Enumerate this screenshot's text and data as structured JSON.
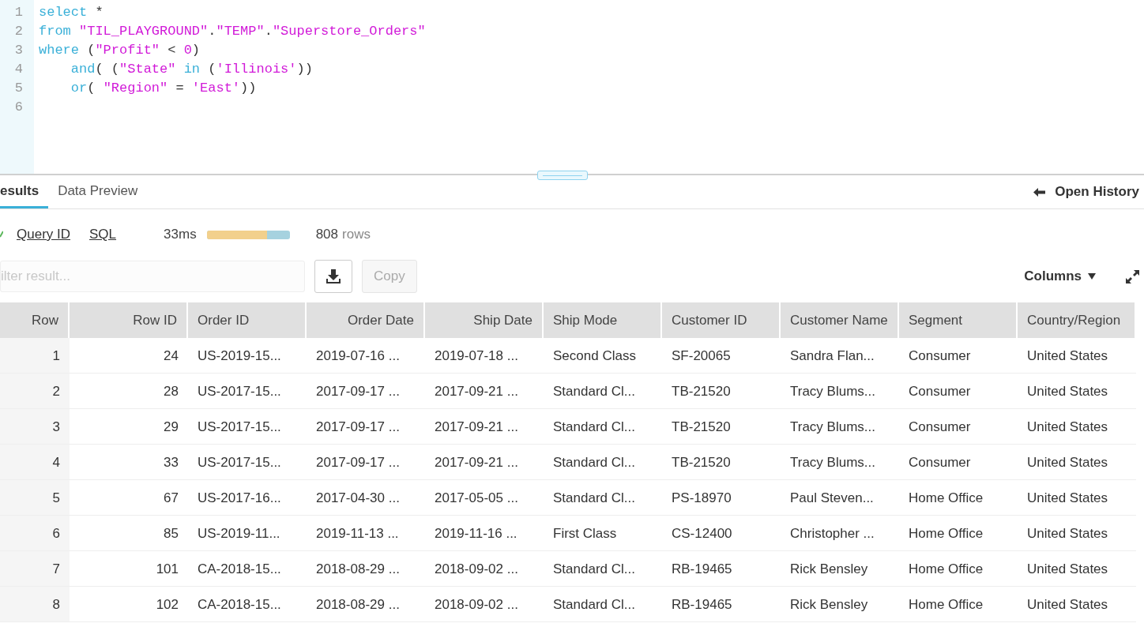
{
  "editor": {
    "lines": [
      {
        "number": "1",
        "tokens": [
          {
            "kind": "keyword",
            "text": "select"
          },
          {
            "kind": "plain",
            "text": " *"
          }
        ]
      },
      {
        "number": "2",
        "tokens": [
          {
            "kind": "keyword",
            "text": "from "
          },
          {
            "kind": "string",
            "text": "\"TIL_PLAYGROUND\""
          },
          {
            "kind": "plain",
            "text": "."
          },
          {
            "kind": "string",
            "text": "\"TEMP\""
          },
          {
            "kind": "plain",
            "text": "."
          },
          {
            "kind": "string",
            "text": "\"Superstore_Orders\""
          }
        ]
      },
      {
        "number": "3",
        "tokens": [
          {
            "kind": "keyword",
            "text": "where"
          },
          {
            "kind": "plain",
            "text": " ("
          },
          {
            "kind": "string",
            "text": "\"Profit\""
          },
          {
            "kind": "plain",
            "text": " < "
          },
          {
            "kind": "string",
            "text": "0"
          },
          {
            "kind": "plain",
            "text": ")"
          }
        ]
      },
      {
        "number": "4",
        "tokens": [
          {
            "kind": "keyword",
            "text": "    and"
          },
          {
            "kind": "plain",
            "text": "( ("
          },
          {
            "kind": "string",
            "text": "\"State\""
          },
          {
            "kind": "keyword",
            "text": " in"
          },
          {
            "kind": "plain",
            "text": " ("
          },
          {
            "kind": "string",
            "text": "'Illinois'"
          },
          {
            "kind": "plain",
            "text": "))"
          }
        ]
      },
      {
        "number": "5",
        "tokens": [
          {
            "kind": "keyword",
            "text": "    or"
          },
          {
            "kind": "plain",
            "text": "( "
          },
          {
            "kind": "string",
            "text": "\"Region\""
          },
          {
            "kind": "plain",
            "text": " = "
          },
          {
            "kind": "string",
            "text": "'East'"
          },
          {
            "kind": "plain",
            "text": "))"
          }
        ]
      },
      {
        "number": "6"
      }
    ]
  },
  "tabs": [
    {
      "label": "esults",
      "selected": true
    },
    {
      "label": "Data Preview",
      "selected": false
    }
  ],
  "open_history": "Open History",
  "info": {
    "query_id": "Query ID",
    "sql": "SQL",
    "duration": "33ms",
    "duration_bar": {
      "level": 0.73
    },
    "row_count": "808",
    "rows_label": "rows"
  },
  "filter": {
    "placeholder": "ilter result..."
  },
  "copy_button": {
    "label": "Copy",
    "disabled": true
  },
  "columns_button": "Columns",
  "table": {
    "columns": [
      {
        "label": "Row",
        "numeric": true
      },
      {
        "label": "Row ID",
        "numeric": true
      },
      {
        "label": "Order ID",
        "numeric": false
      },
      {
        "label": "Order Date",
        "numeric": true
      },
      {
        "label": "Ship Date",
        "numeric": true
      },
      {
        "label": "Ship Mode",
        "numeric": false
      },
      {
        "label": "Customer ID",
        "numeric": false
      },
      {
        "label": "Customer Name",
        "numeric": false
      },
      {
        "label": "Segment",
        "numeric": false
      },
      {
        "label": "Country/Region",
        "numeric": false
      }
    ],
    "rows": [
      [
        "1",
        "24",
        "US-2019-15...",
        "2019-07-16 ...",
        "2019-07-18 ...",
        "Second Class",
        "SF-20065",
        "Sandra Flan...",
        "Consumer",
        "United States"
      ],
      [
        "2",
        "28",
        "US-2017-15...",
        "2017-09-17 ...",
        "2017-09-21 ...",
        "Standard Cl...",
        "TB-21520",
        "Tracy Blums...",
        "Consumer",
        "United States"
      ],
      [
        "3",
        "29",
        "US-2017-15...",
        "2017-09-17 ...",
        "2017-09-21 ...",
        "Standard Cl...",
        "TB-21520",
        "Tracy Blums...",
        "Consumer",
        "United States"
      ],
      [
        "4",
        "33",
        "US-2017-15...",
        "2017-09-17 ...",
        "2017-09-21 ...",
        "Standard Cl...",
        "TB-21520",
        "Tracy Blums...",
        "Consumer",
        "United States"
      ],
      [
        "5",
        "67",
        "US-2017-16...",
        "2017-04-30 ...",
        "2017-05-05 ...",
        "Standard Cl...",
        "PS-18970",
        "Paul Steven...",
        "Home Office",
        "United States"
      ],
      [
        "6",
        "85",
        "US-2019-11...",
        "2019-11-13 ...",
        "2019-11-16 ...",
        "First Class",
        "CS-12400",
        "Christopher ...",
        "Home Office",
        "United States"
      ],
      [
        "7",
        "101",
        "CA-2018-15...",
        "2018-08-29 ...",
        "2018-09-02 ...",
        "Standard Cl...",
        "RB-19465",
        "Rick Bensley",
        "Home Office",
        "United States"
      ],
      [
        "8",
        "102",
        "CA-2018-15...",
        "2018-08-29 ...",
        "2018-09-02 ...",
        "Standard Cl...",
        "RB-19465",
        "Rick Bensley",
        "Home Office",
        "United States"
      ]
    ]
  }
}
